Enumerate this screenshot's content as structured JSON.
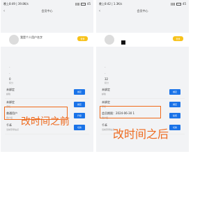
{
  "left": {
    "status_time": "晚上8:49 | 39.8K/s",
    "battery": "45",
    "title": "会员中心",
    "profile_name": "我是个人用户名字",
    "cta_label": "登录",
    "dash": "-",
    "field_a_value": "0",
    "field_a_label": "积分",
    "rows": [
      {
        "t1": "未绑定",
        "t2": "邮箱",
        "btn": "绑定"
      },
      {
        "t1": "未绑定",
        "t2": "手机",
        "btn": "绑定"
      },
      {
        "t1": "普通用户",
        "t2": "用户组",
        "btn": "升级"
      },
      {
        "t1": "千禾",
        "t2": "当前登录站点",
        "btn": "切换"
      }
    ]
  },
  "right": {
    "status_time": "晚上8:42 | 1.3K/s",
    "battery": "45",
    "title": "会员中心",
    "cta_label": "登录",
    "dash": "-",
    "field_a_value": "32",
    "field_a_label": "积分",
    "rows": [
      {
        "t1": "未绑定",
        "t2": "邮箱",
        "btn": "绑定"
      },
      {
        "t1": "未绑定",
        "t2": "手机",
        "btn": "绑定"
      },
      {
        "t1": "会员期限：2024-06-30 1",
        "t2": "用户组",
        "btn": "续费"
      },
      {
        "t1": "千禾",
        "t2": "当前登录站点",
        "btn": "切换"
      }
    ]
  },
  "caption_before": "改时间之前",
  "caption_after": "改时间之后",
  "colors": {
    "accent_blue": "#1a73e8",
    "highlight_orange": "#f06a1a",
    "cta_yellow": "#f7c21a"
  }
}
